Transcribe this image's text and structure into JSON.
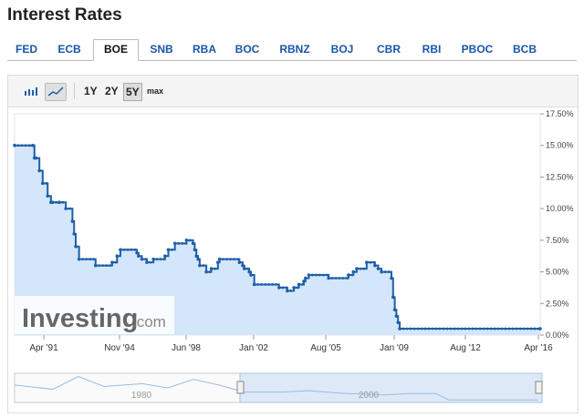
{
  "title": "Interest Rates",
  "tabs": [
    "FED",
    "ECB",
    "BOE",
    "SNB",
    "RBA",
    "BOC",
    "RBNZ",
    "BOJ",
    "CBR",
    "RBI",
    "PBOC",
    "BCB"
  ],
  "active_tab": "BOE",
  "toolbar": {
    "chart_type_icons": [
      "bar-chart-icon",
      "area-chart-icon"
    ],
    "ranges": [
      "1Y",
      "2Y",
      "5Y",
      "max"
    ],
    "active_range": "5Y"
  },
  "watermark": {
    "brand": "Investing",
    "suffix": ".com"
  },
  "colors": {
    "line": "#1f5fa8",
    "fill": "#cfe3f8",
    "tab_link": "#1a56a8"
  },
  "chart_data": {
    "type": "area",
    "title": "",
    "xlabel": "",
    "ylabel": "",
    "x_tick_labels": [
      "Apr '91",
      "Nov '94",
      "Jun '98",
      "Jan '02",
      "Aug '05",
      "Jan '09",
      "Aug '12",
      "Apr '16"
    ],
    "y_tick_labels": [
      "0.00%",
      "2.50%",
      "5.00%",
      "7.50%",
      "10.00%",
      "12.50%",
      "15.00%",
      "17.50%"
    ],
    "ylim": [
      0,
      17.5
    ],
    "xlim": [
      "1989-10",
      "2016-04"
    ],
    "grid": false,
    "series": [
      {
        "x": [
          "1989-10",
          "1990-09",
          "1990-10",
          "1990-11",
          "1991-01",
          "1991-03",
          "1991-06",
          "1991-08",
          "1991-09",
          "1992-01",
          "1992-05",
          "1992-09",
          "1992-10",
          "1992-11",
          "1993-01",
          "1993-11",
          "1994-09",
          "1994-12",
          "1995-02",
          "1995-12",
          "1996-01",
          "1996-03",
          "1996-06",
          "1996-10",
          "1997-05",
          "1997-07",
          "1997-11",
          "1998-06",
          "1998-10",
          "1998-11",
          "1998-12",
          "1999-01",
          "1999-02",
          "1999-06",
          "1999-09",
          "2000-01",
          "2000-02",
          "2001-02",
          "2001-04",
          "2001-05",
          "2001-08",
          "2001-09",
          "2001-11",
          "2003-02",
          "2003-07",
          "2003-11",
          "2004-02",
          "2004-05",
          "2004-06",
          "2004-08",
          "2005-08",
          "2006-08",
          "2006-11",
          "2007-01",
          "2007-07",
          "2007-12",
          "2008-02",
          "2008-04",
          "2008-10",
          "2008-11",
          "2008-12",
          "2009-01",
          "2009-02",
          "2009-03",
          "2016-04"
        ],
        "y": [
          15.0,
          15.0,
          14.0,
          14.0,
          13.0,
          12.0,
          11.0,
          10.5,
          10.5,
          10.5,
          10.0,
          9.0,
          8.0,
          7.0,
          6.0,
          5.5,
          5.75,
          6.25,
          6.75,
          6.5,
          6.25,
          6.0,
          5.75,
          6.0,
          6.25,
          6.75,
          7.25,
          7.5,
          7.25,
          6.75,
          6.25,
          6.0,
          5.5,
          5.0,
          5.25,
          5.75,
          6.0,
          5.75,
          5.5,
          5.25,
          5.0,
          4.75,
          4.0,
          3.75,
          3.5,
          3.75,
          4.0,
          4.25,
          4.5,
          4.75,
          4.5,
          4.75,
          5.0,
          5.25,
          5.75,
          5.5,
          5.25,
          5.0,
          4.5,
          3.0,
          2.0,
          1.5,
          1.0,
          0.5,
          0.5
        ]
      }
    ],
    "navigator": {
      "labels": [
        "1980",
        "2000"
      ],
      "overview_x": [
        "1975",
        "1978",
        "1980",
        "1982",
        "1985",
        "1987",
        "1989",
        "1991",
        "1993",
        "1996",
        "1998",
        "2001",
        "2004",
        "2006",
        "2008",
        "2009",
        "2016"
      ],
      "overview_y": [
        11,
        8,
        17,
        10,
        12,
        9,
        15,
        11,
        6,
        6,
        7,
        5,
        4,
        5,
        5,
        0.5,
        0.5
      ]
    }
  }
}
